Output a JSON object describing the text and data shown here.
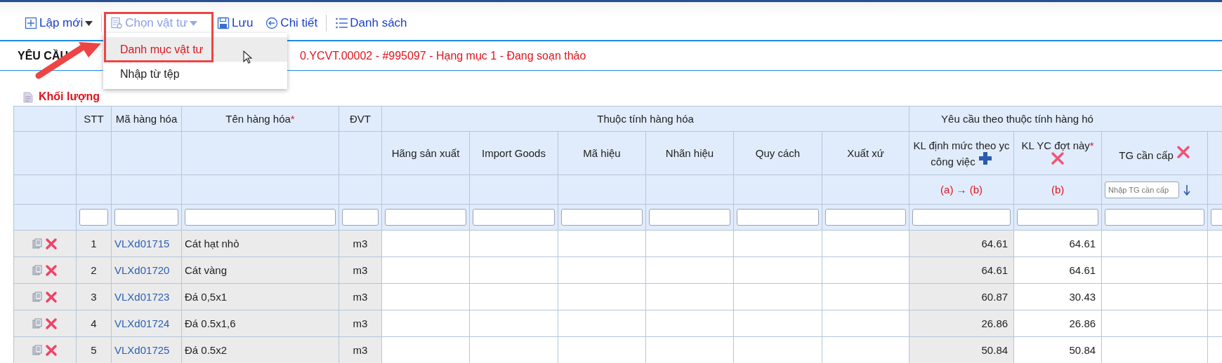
{
  "toolbar": [
    {
      "label": "Lập mới",
      "has_menu": true,
      "expanded": false
    },
    {
      "label": "Chọn vật tư",
      "has_menu": true,
      "expanded": true
    },
    {
      "label": "Lưu",
      "has_menu": false,
      "expanded": false
    },
    {
      "label": "Chi tiết",
      "has_menu": false,
      "expanded": false
    },
    {
      "label": "Danh sách",
      "has_menu": false,
      "expanded": false
    }
  ],
  "menu": {
    "items": [
      {
        "label": "Danh mục vật tư",
        "selected": true
      },
      {
        "label": "Nhập từ tệp",
        "selected": false
      }
    ]
  },
  "page_title": {
    "label": "YÊU CẦU",
    "status": "0.YCVT.00002 - #995097 - Hạng mục 1 - Đang soạn thảo"
  },
  "section": {
    "title": "Khối lượng"
  },
  "table": {
    "columns": [
      {
        "label": "STT"
      },
      {
        "label": "Mã hàng hóa"
      },
      {
        "label": "Tên hàng hóa",
        "required_mark": "*"
      },
      {
        "label": "ĐVT"
      }
    ],
    "attribute_group": {
      "label": "Thuộc tính hàng hóa",
      "columns": [
        "Hãng sản xuất",
        "Import Goods",
        "Mã hiệu",
        "Nhãn hiệu",
        "Quy cách",
        "Xuất xứ"
      ]
    },
    "request_group": {
      "label": "Yêu cầu theo thuộc tính hàng hó",
      "columns": [
        {
          "label": "KL định mức theo yc công việc",
          "kind": "add",
          "hint": [
            {
              "text": "(a)",
              "kind": "ref"
            },
            {
              "text": "→",
              "kind": "arrow"
            },
            {
              "text": "(b)",
              "kind": "ref"
            }
          ]
        },
        {
          "label": "KL YC đợt này",
          "required_mark": "*",
          "kind": "remove",
          "hint": [
            {
              "text": "(b)",
              "kind": "ref"
            }
          ]
        },
        {
          "label": "TG cần cấp",
          "kind": "remove",
          "placeholder": "Nhập TG cần cấp"
        }
      ]
    },
    "rows": [
      {
        "stt": "1",
        "code": "VLXd01715",
        "name": "Cát hạt nhỏ",
        "unit": "m3",
        "kl_norm": "64.61",
        "kl_request": "64.61"
      },
      {
        "stt": "2",
        "code": "VLXd01720",
        "name": "Cát vàng",
        "unit": "m3",
        "kl_norm": "64.61",
        "kl_request": "64.61"
      },
      {
        "stt": "3",
        "code": "VLXd01723",
        "name": "Đá 0,5x1",
        "unit": "m3",
        "kl_norm": "60.87",
        "kl_request": "30.43"
      },
      {
        "stt": "4",
        "code": "VLXd01724",
        "name": "Đá 0.5x1,6",
        "unit": "m3",
        "kl_norm": "26.86",
        "kl_request": "26.86"
      },
      {
        "stt": "5",
        "code": "VLXd01725",
        "name": "Đá 0.5x2",
        "unit": "m3",
        "kl_norm": "50.84",
        "kl_request": "50.84"
      }
    ]
  }
}
